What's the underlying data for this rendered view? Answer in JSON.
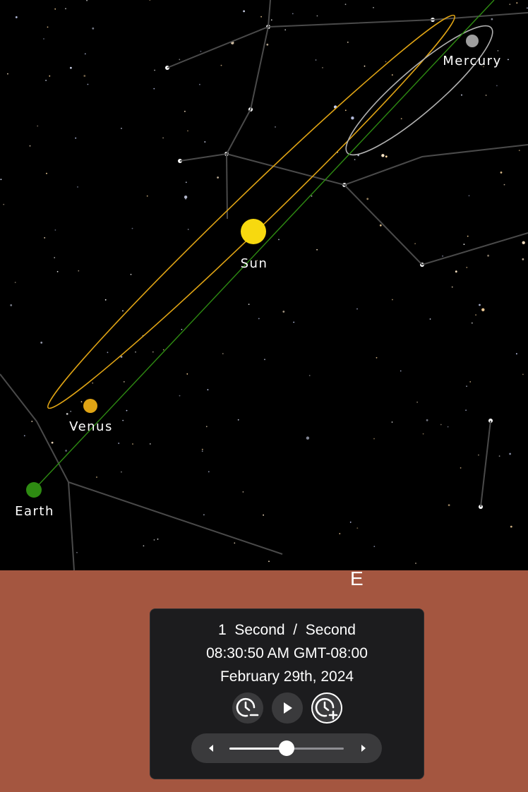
{
  "compass": {
    "direction": "E"
  },
  "bodies": [
    {
      "name": "Mercury",
      "color": "#9e9e9e"
    },
    {
      "name": "Sun",
      "color": "#f7d90f"
    },
    {
      "name": "Venus",
      "color": "#e0a414"
    },
    {
      "name": "Earth",
      "color": "#2e8b12"
    }
  ],
  "panel": {
    "rate": "1  Second  /  Second",
    "time": "08:30:50 AM GMT-08:00",
    "date": "February 29th, 2024",
    "speed_level": 0.5
  },
  "colors": {
    "ground": "#a45640",
    "panel": "#1c1c1e",
    "button": "#3a3a3c",
    "venus_orbit": "#e0a414",
    "earth_orbit": "#2e8b12",
    "mercury_orbit": "#b0b0b0"
  },
  "icons": {
    "slow_down": "clock-minus-icon",
    "play": "play-icon",
    "speed_up": "clock-plus-icon",
    "left": "chevron-left-icon",
    "right": "chevron-right-icon"
  }
}
